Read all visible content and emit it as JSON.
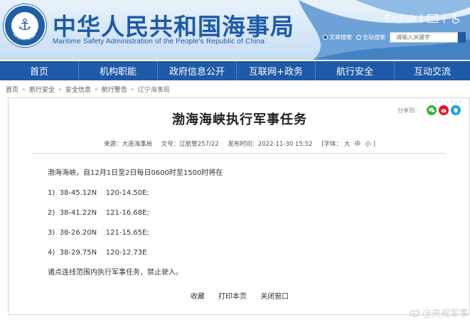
{
  "header": {
    "title_cn": "中华人民共和国海事局",
    "title_en": "Maritime Safety Administration of the People's Republic of China",
    "logo_ring_text": "CHINA MSA",
    "english_link": "English",
    "separator": "|",
    "icons": [
      "mail-icon",
      "accessibility-icon"
    ]
  },
  "search": {
    "option_site": "文章搜索",
    "option_all": "全站搜索",
    "placeholder": "请输入关键字"
  },
  "nav": {
    "items": [
      "首页",
      "机构职能",
      "政府信息公开",
      "互联网+政务",
      "航行安全",
      "互动交流"
    ]
  },
  "breadcrumb": {
    "items": [
      "首页",
      "航行安全",
      "安全信息",
      "航行警告",
      "辽宁海事局"
    ],
    "separator": "»"
  },
  "share": {
    "label": "分享到："
  },
  "article": {
    "title": "渤海海峡执行军事任务",
    "source": "来源：大连海事局",
    "doc_no": "文号：辽航警257/22",
    "published": "发布时间：2022-11-30 15:52",
    "font_label": "[字体：",
    "font_large": "大",
    "font_medium": "中",
    "font_small": "小",
    "font_close": "]",
    "intro": "渤海海峡，自12月1日至2日每日0600时至1500时将在",
    "points": [
      "1)  38-45.12N    120-14.50E;",
      "2)  38-41.22N    121-16.68E;",
      "3)  38-26.20N    121-15.65E;",
      "4)  38-29.75N    120-12.73E"
    ],
    "conclusion": "诸点连线范围内执行军事任务，禁止驶入。"
  },
  "actions": {
    "collect": "收藏",
    "print": "打印本页",
    "close": "关闭窗口"
  },
  "watermark": {
    "text": "@央视军事"
  },
  "colors": {
    "brand_blue": "#1e5aa8",
    "nav_bg": "#1e5aa8",
    "wechat": "#35b535",
    "weibo": "#e6162d",
    "qq": "#1aa1e6"
  }
}
